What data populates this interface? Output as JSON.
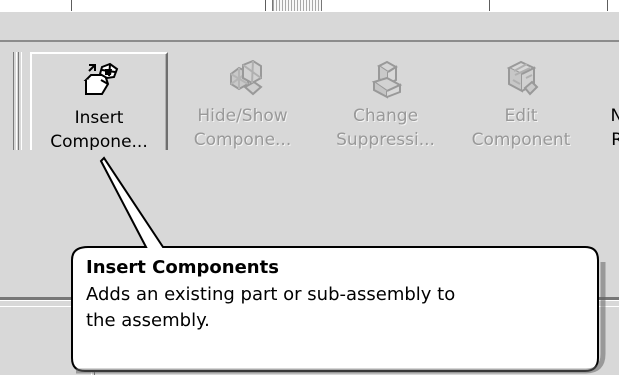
{
  "toolbar": {
    "buttons": [
      {
        "label_line_1": "Insert",
        "label_line_2": "Compone...",
        "icon": "insert-components-icon",
        "state": "selected"
      },
      {
        "label_line_1": "Hide/Show",
        "label_line_2": "Compone...",
        "icon": "hide-show-components-icon",
        "state": "disabled"
      },
      {
        "label_line_1": "Change",
        "label_line_2": "Suppressi...",
        "icon": "change-suppression-icon",
        "state": "disabled"
      },
      {
        "label_line_1": "Edit",
        "label_line_2": "Component",
        "icon": "edit-component-icon",
        "state": "disabled"
      },
      {
        "label_line_1": "No",
        "label_line_2": "Re",
        "icon": "",
        "state": "normal"
      }
    ]
  },
  "tooltip": {
    "title": "Insert Components",
    "body_line_1": "Adds an existing part or sub-assembly to",
    "body_line_2": "the assembly."
  },
  "colors": {
    "background": "#d8d8d8",
    "disabled_text": "#999999",
    "tooltip_background": "#ffffff",
    "tooltip_border": "#000000"
  }
}
